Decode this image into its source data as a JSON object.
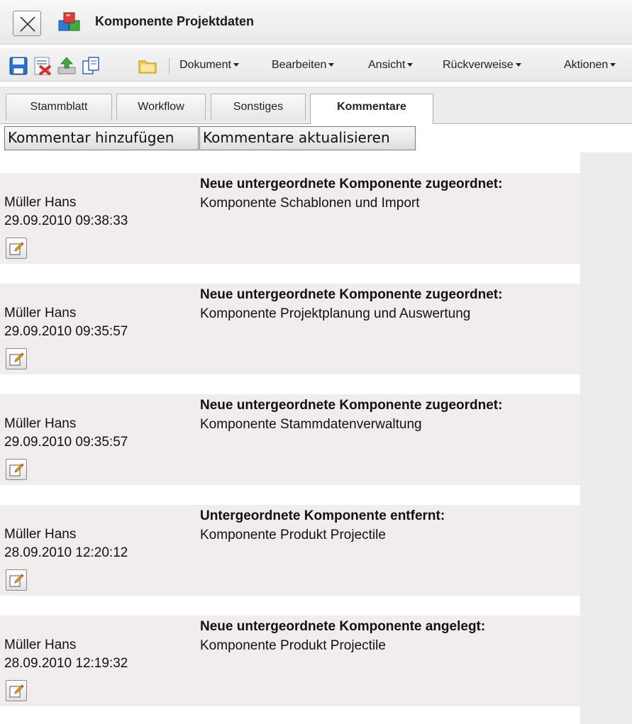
{
  "window": {
    "title": "Komponente Projektdaten",
    "close_icon": "close-icon",
    "app_icon": "component-cubes-icon"
  },
  "toolbar": {
    "icons": [
      "save-icon",
      "delete-icon",
      "upload-icon",
      "copy-icon",
      "folder-icon"
    ],
    "menus": [
      "Dokument",
      "Bearbeiten",
      "Ansicht",
      "Rückverweise",
      "Aktionen"
    ]
  },
  "tabs": [
    {
      "label": "Stammblatt",
      "active": false
    },
    {
      "label": "Workflow",
      "active": false
    },
    {
      "label": "Sonstiges",
      "active": false
    },
    {
      "label": "Kommentare",
      "active": true
    }
  ],
  "actions": {
    "add_comment": "Kommentar hinzufügen",
    "refresh_comments": "Kommentare aktualisieren"
  },
  "comments": [
    {
      "author": "Müller Hans",
      "date": "29.09.2010 09:38:33",
      "heading": "Neue untergeordnete Komponente zugeordnet:",
      "text": "Komponente Schablonen und Import"
    },
    {
      "author": "Müller Hans",
      "date": "29.09.2010 09:35:57",
      "heading": "Neue untergeordnete Komponente zugeordnet:",
      "text": "Komponente Projektplanung und Auswertung"
    },
    {
      "author": "Müller Hans",
      "date": "29.09.2010 09:35:57",
      "heading": "Neue untergeordnete Komponente zugeordnet:",
      "text": "Komponente Stammdatenverwaltung"
    },
    {
      "author": "Müller Hans",
      "date": "28.09.2010 12:20:12",
      "heading": "Untergeordnete Komponente entfernt:",
      "text": "Komponente Produkt Projectile"
    },
    {
      "author": "Müller Hans",
      "date": "28.09.2010 12:19:32",
      "heading": "Neue untergeordnete Komponente angelegt:",
      "text": "Komponente Produkt Projectile"
    }
  ],
  "colors": {
    "comment_bg": "#f1eded",
    "panel_bg": "#ececec"
  }
}
